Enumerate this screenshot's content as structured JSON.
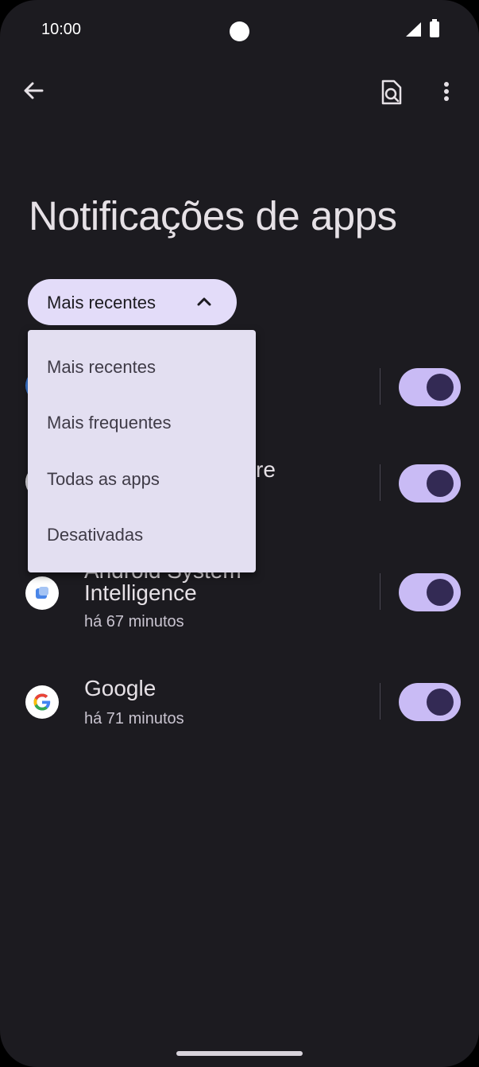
{
  "status_bar": {
    "time": "10:00"
  },
  "page": {
    "title": "Notificações de apps"
  },
  "sort_chip": {
    "label": "Mais recentes"
  },
  "sort_menu": {
    "items": [
      {
        "label": "Mais recentes"
      },
      {
        "label": "Mais frequentes"
      },
      {
        "label": "Todas as apps"
      },
      {
        "label": "Desativadas"
      }
    ]
  },
  "apps": [
    {
      "name": "",
      "subtitle": "",
      "enabled": true
    },
    {
      "name": "re",
      "subtitle": "",
      "enabled": true
    },
    {
      "name": "Intelligence",
      "name_partial": "Android System",
      "subtitle": "há 67 minutos",
      "enabled": true
    },
    {
      "name": "Google",
      "subtitle": "há 71 minutos",
      "enabled": true
    }
  ],
  "colors": {
    "background": "#1c1b20",
    "chip": "#e3dcf9",
    "menu": "#e3dff1",
    "switch_track": "#c9bbf5",
    "switch_knob": "#332a54"
  }
}
